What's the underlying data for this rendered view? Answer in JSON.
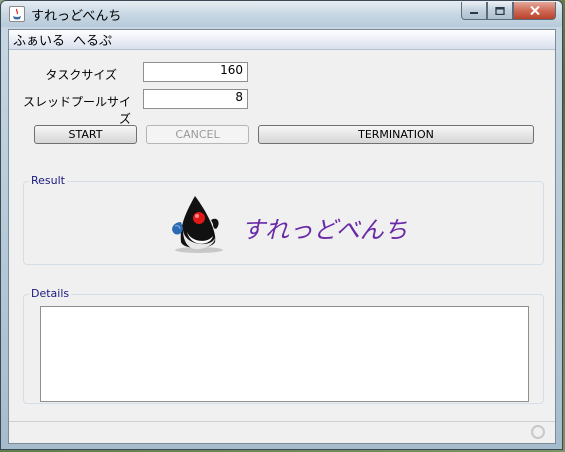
{
  "window": {
    "title": "すれっどべんち"
  },
  "menubar": {
    "items": [
      {
        "label": "ふぁいる"
      },
      {
        "label": "へるぷ"
      }
    ]
  },
  "form": {
    "task_size_label": "タスクサイズ",
    "task_size_value": "160",
    "pool_size_label": "スレッドプールサイズ",
    "pool_size_value": "8"
  },
  "buttons": {
    "start": "START",
    "cancel": "CANCEL",
    "termination": "TERMINATION"
  },
  "result": {
    "title": "Result",
    "banner_text": "すれっどべんち",
    "mascot": "java-duke-mascot-icon"
  },
  "details": {
    "title": "Details",
    "content": ""
  },
  "colors": {
    "banner_text": "#6a2aa8",
    "group_title": "#1a1a80"
  }
}
